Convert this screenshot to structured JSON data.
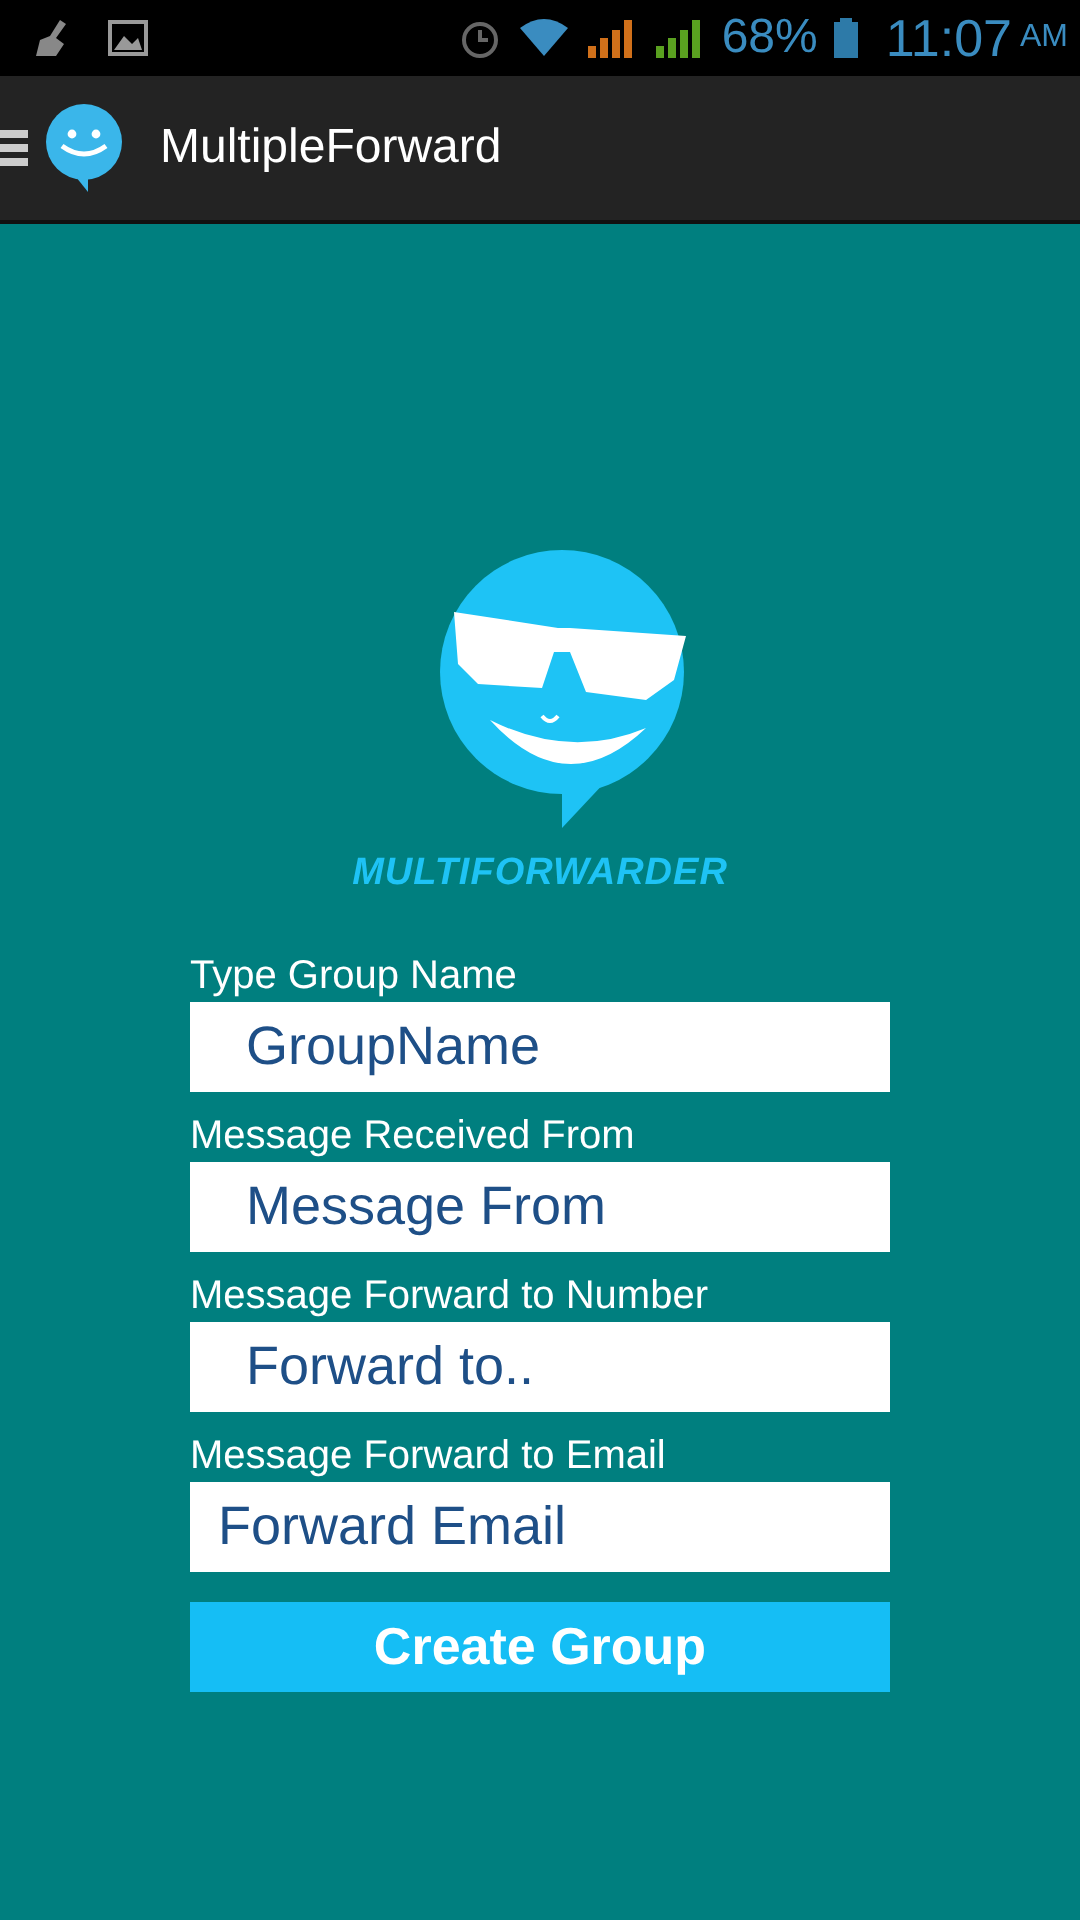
{
  "status_bar": {
    "battery": "68%",
    "time": "11:07",
    "meridiem": "AM"
  },
  "action_bar": {
    "title": "MultipleForward"
  },
  "logo": {
    "wordmark": "MULTIFORWARDER"
  },
  "form": {
    "fields": [
      {
        "label": "Type Group Name",
        "placeholder": "GroupName",
        "kind": "text"
      },
      {
        "label": "Message Received From",
        "placeholder": "Message From",
        "kind": "text"
      },
      {
        "label": "Message Forward to Number",
        "placeholder": "Forward to..",
        "kind": "text"
      },
      {
        "label": "Message Forward to Email",
        "placeholder": "Forward Email",
        "kind": "email"
      }
    ],
    "button": "Create Group"
  }
}
